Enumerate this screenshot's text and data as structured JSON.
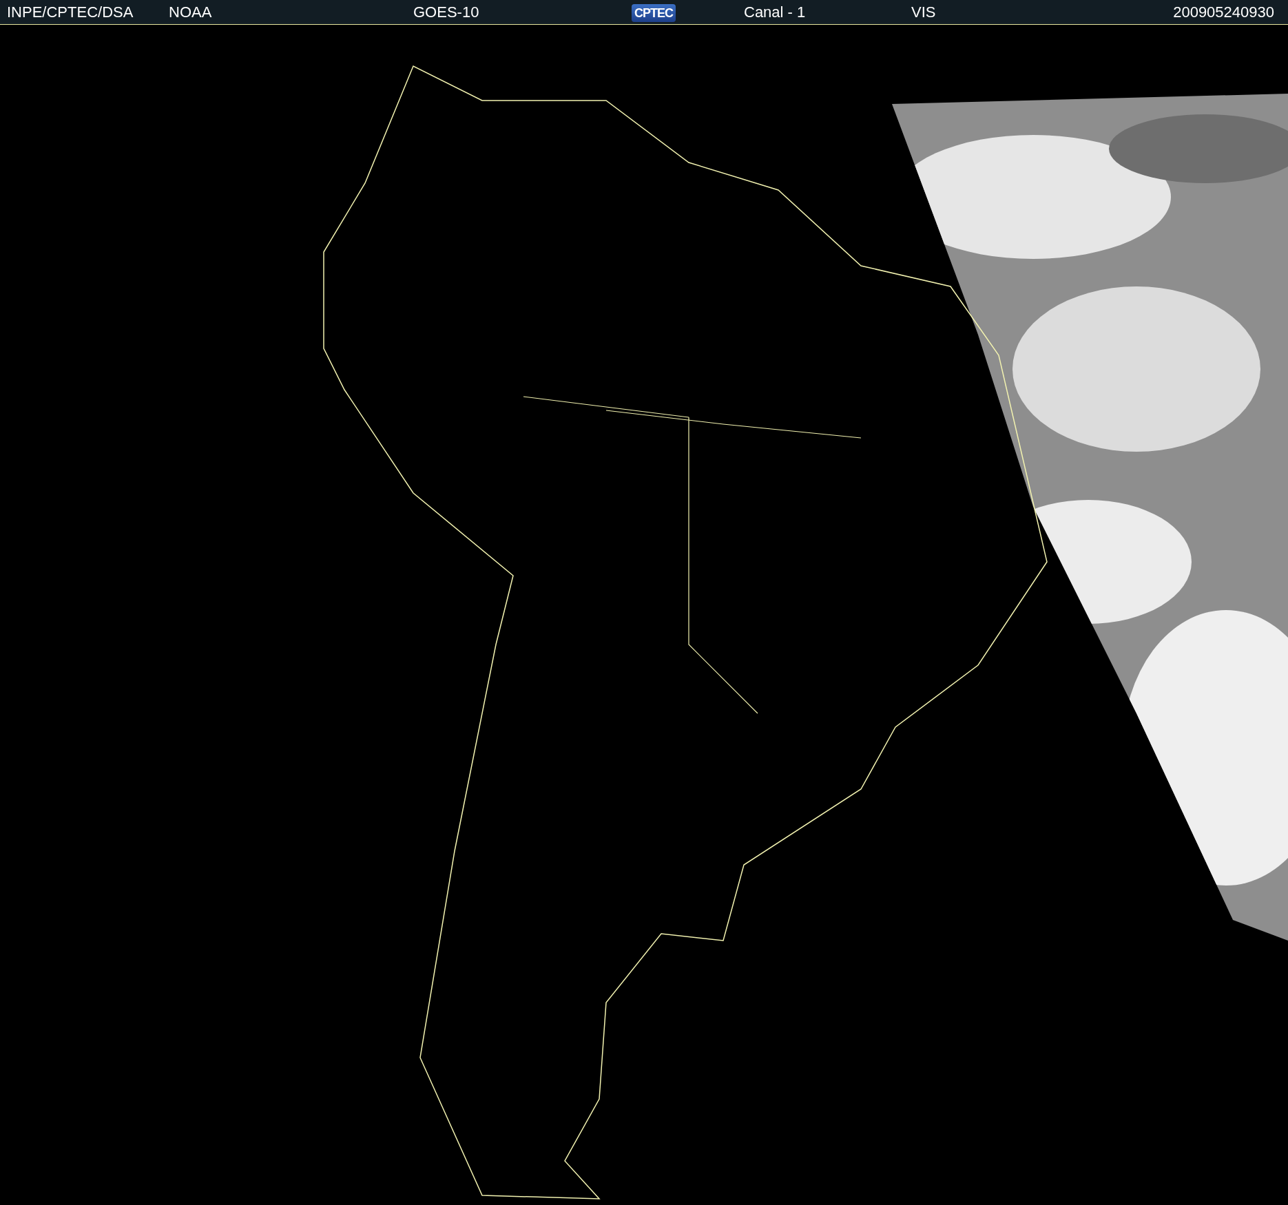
{
  "header": {
    "source": "INPE/CPTEC/DSA",
    "agency": "NOAA",
    "satellite": "GOES-10",
    "logo": "CPTEC",
    "channel": "Canal - 1",
    "band": "VIS",
    "timestamp": "200905240930"
  }
}
